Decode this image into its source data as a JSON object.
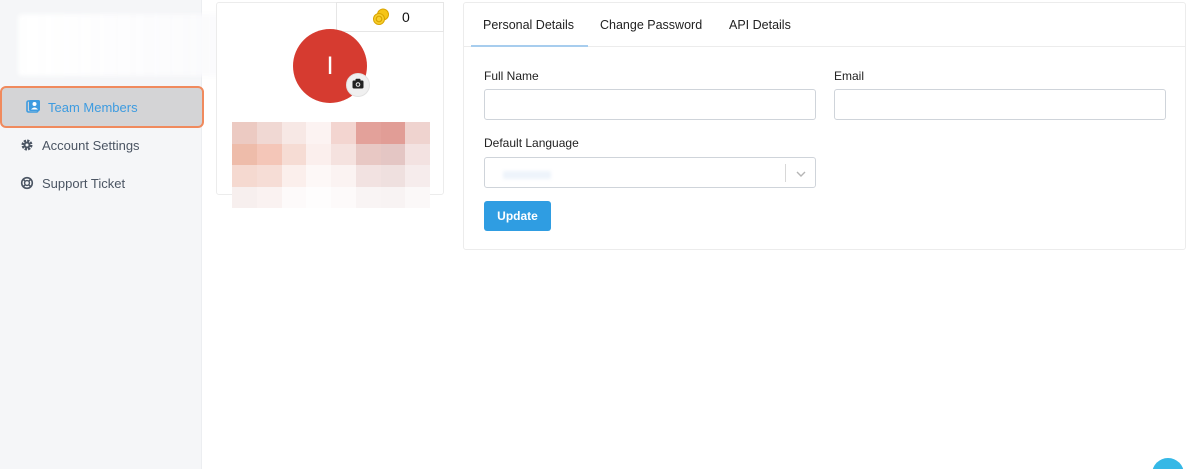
{
  "sidebar": {
    "items": [
      {
        "label": "Team Members",
        "icon": "team-members-icon",
        "active": true
      },
      {
        "label": "Account Settings",
        "icon": "gear-icon",
        "active": false
      },
      {
        "label": "Support Ticket",
        "icon": "lifebuoy-icon",
        "active": false
      }
    ]
  },
  "profile": {
    "coins": "0",
    "avatar_initial": "I"
  },
  "tabs": [
    {
      "label": "Personal Details",
      "active": true
    },
    {
      "label": "Change Password",
      "active": false
    },
    {
      "label": "API Details",
      "active": false
    }
  ],
  "form": {
    "full_name_label": "Full Name",
    "full_name_value": "",
    "email_label": "Email",
    "email_value": "",
    "language_label": "Default Language",
    "update_label": "Update"
  },
  "colors": {
    "accent": "#2f9de2",
    "avatar_bg": "#d63b30",
    "active_nav_text": "#3d9be0",
    "active_nav_outline": "#f08a5d"
  }
}
